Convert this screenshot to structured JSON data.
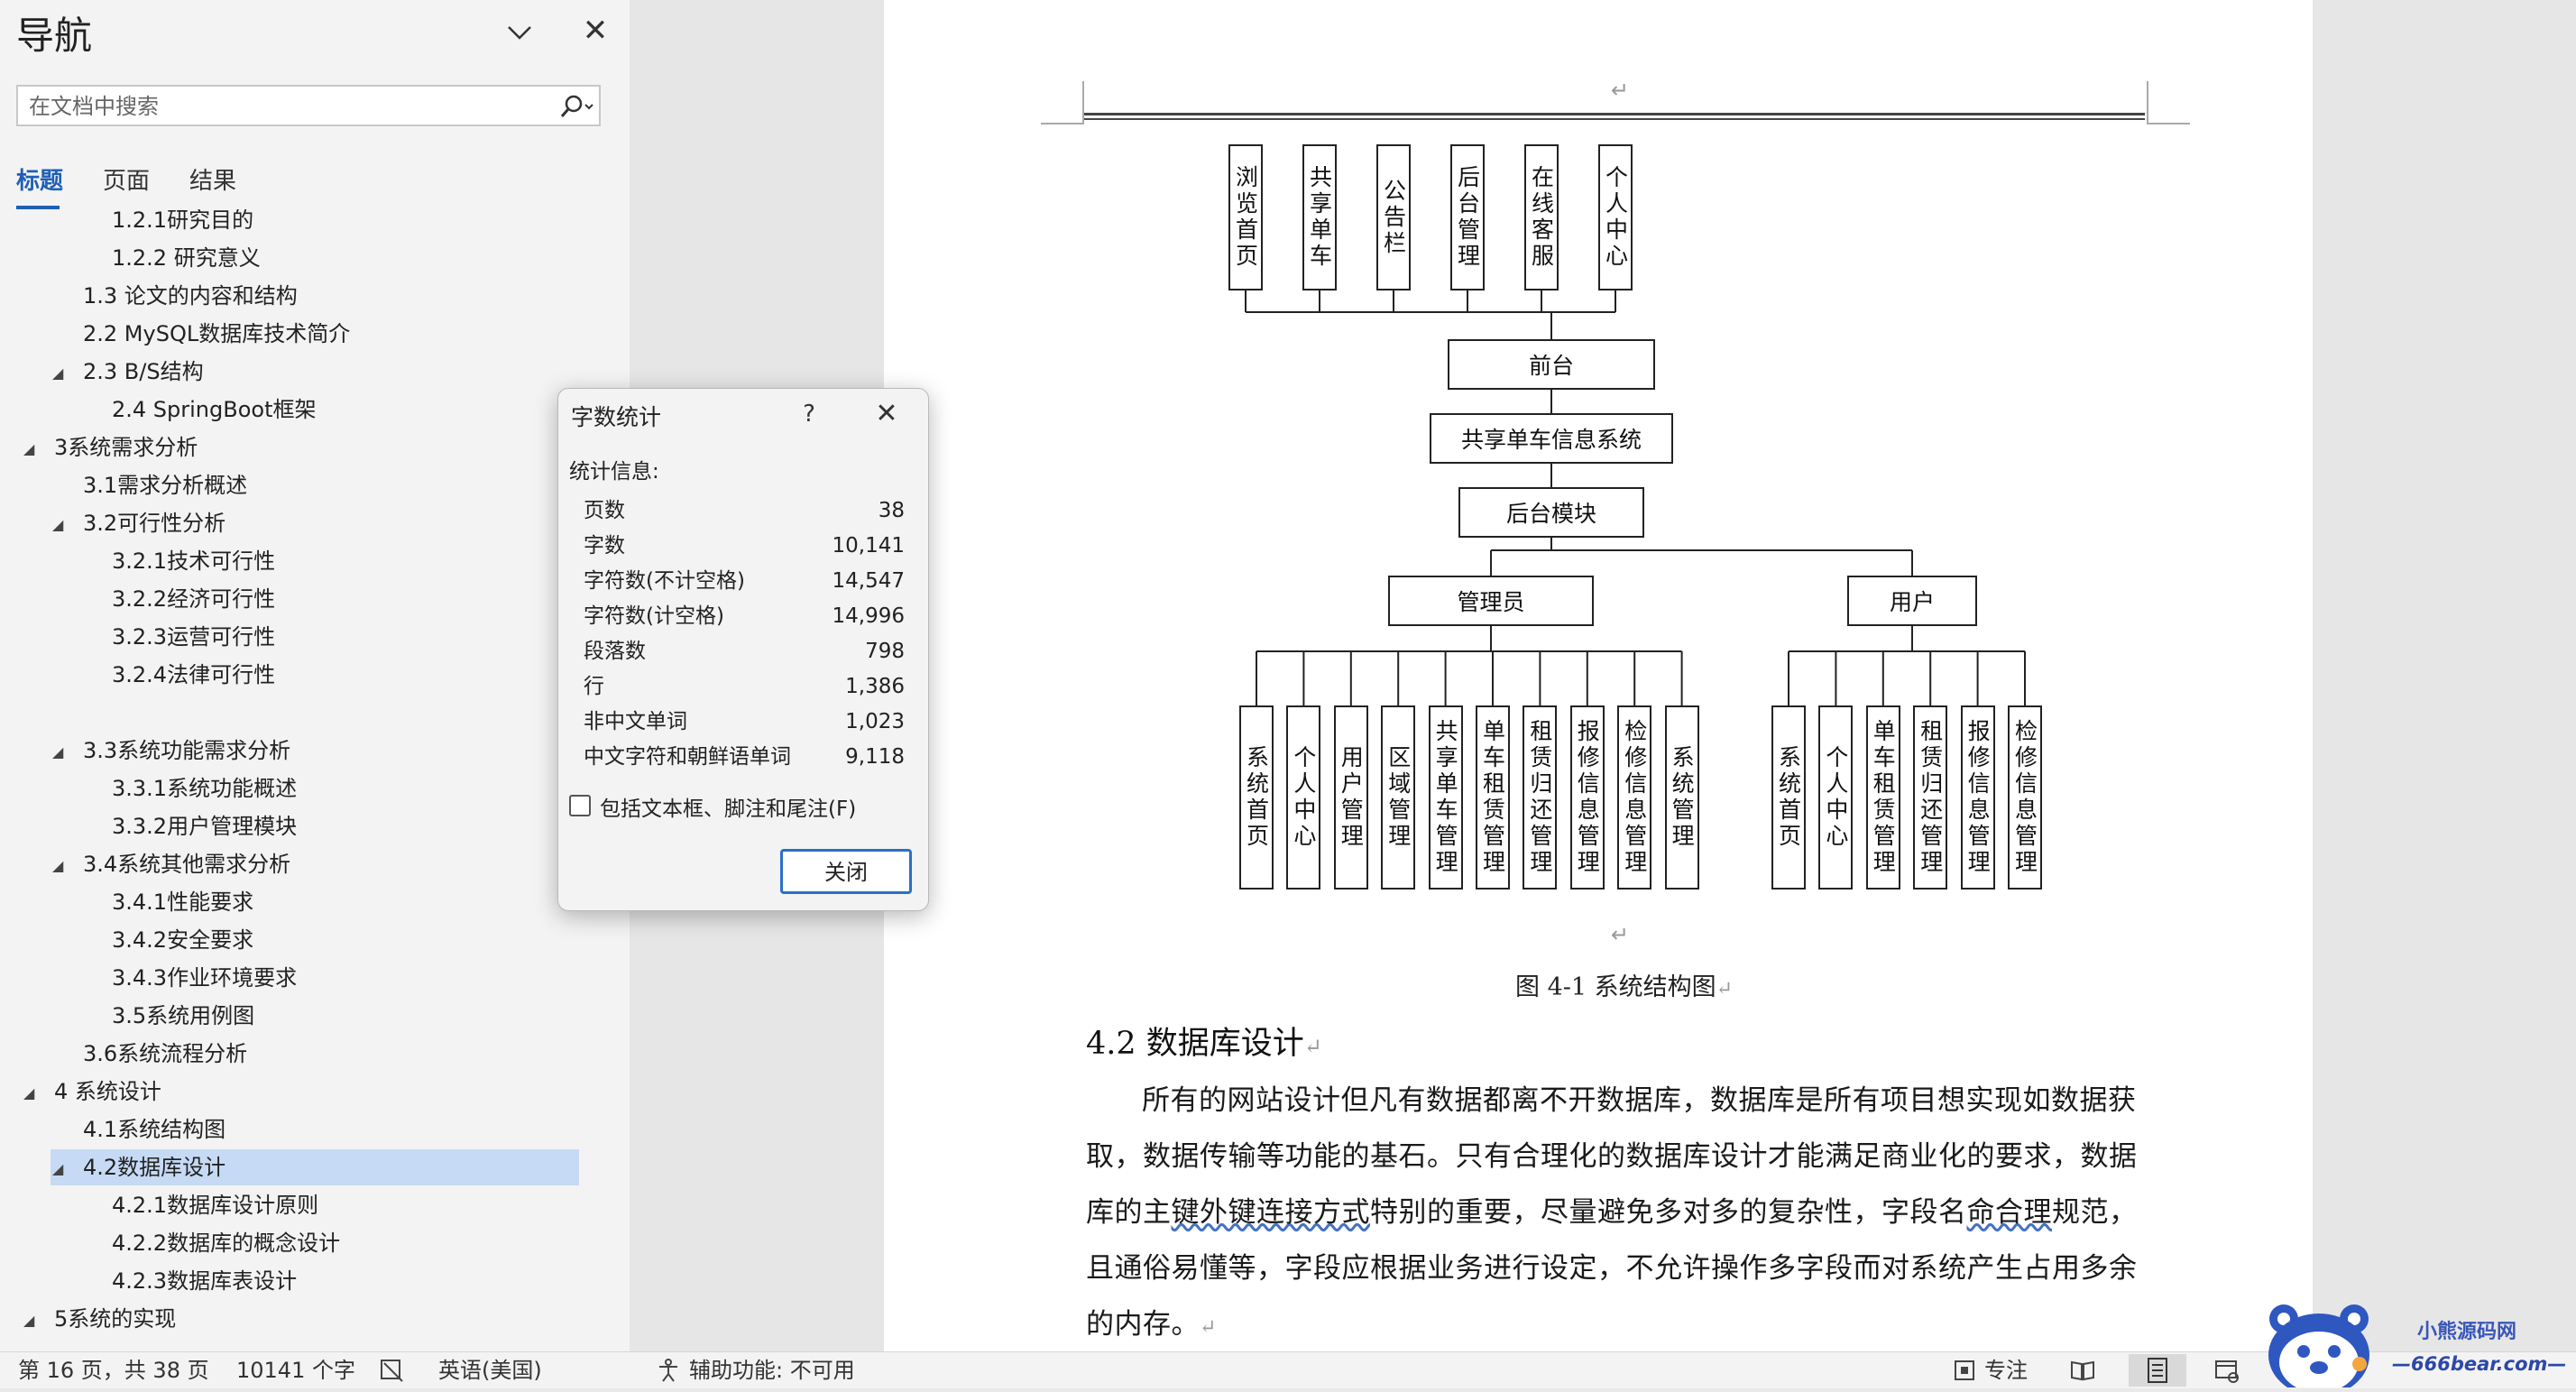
{
  "nav": {
    "title": "导航",
    "search_placeholder": "在文档中搜索",
    "tabs": [
      "标题",
      "页面",
      "结果"
    ],
    "tree": [
      {
        "label": "1.2.1研究目的",
        "level": 3
      },
      {
        "label": "1.2.2 研究意义",
        "level": 3
      },
      {
        "label": "1.3 论文的内容和结构",
        "level": 2
      },
      {
        "label": "2.2 MySQL数据库技术简介",
        "level": 2
      },
      {
        "label": "2.3 B/S结构",
        "level": 2,
        "expanded": true
      },
      {
        "label": "2.4 SpringBoot框架",
        "level": 3
      },
      {
        "label": "3系统需求分析",
        "level": 1,
        "expanded": true
      },
      {
        "label": "3.1需求分析概述",
        "level": 2
      },
      {
        "label": "3.2可行性分析",
        "level": 2,
        "expanded": true
      },
      {
        "label": "3.2.1技术可行性",
        "level": 3
      },
      {
        "label": "3.2.2经济可行性",
        "level": 3
      },
      {
        "label": "3.2.3运营可行性",
        "level": 3
      },
      {
        "label": "3.2.4法律可行性",
        "level": 3
      },
      {
        "label": "",
        "level": 3
      },
      {
        "label": "3.3系统功能需求分析",
        "level": 2,
        "expanded": true
      },
      {
        "label": "3.3.1系统功能概述",
        "level": 3
      },
      {
        "label": "3.3.2用户管理模块",
        "level": 3
      },
      {
        "label": "3.4系统其他需求分析",
        "level": 2,
        "expanded": true
      },
      {
        "label": "3.4.1性能要求",
        "level": 3
      },
      {
        "label": "3.4.2安全要求",
        "level": 3
      },
      {
        "label": "3.4.3作业环境要求",
        "level": 3
      },
      {
        "label": "3.5系统用例图",
        "level": 3
      },
      {
        "label": "3.6系统流程分析",
        "level": 2
      },
      {
        "label": "4 系统设计",
        "level": 1,
        "expanded": true
      },
      {
        "label": "4.1系统结构图",
        "level": 2
      },
      {
        "label": "4.2数据库设计",
        "level": 2,
        "expanded": true,
        "selected": true
      },
      {
        "label": "4.2.1数据库设计原则",
        "level": 3
      },
      {
        "label": "4.2.2数据库的概念设计",
        "level": 3
      },
      {
        "label": "4.2.3数据库表设计",
        "level": 3
      },
      {
        "label": "5系统的实现",
        "level": 1,
        "expanded": true
      }
    ]
  },
  "word_count": {
    "title": "字数统计",
    "help": "?",
    "section": "统计信息:",
    "rows": [
      {
        "label": "页数",
        "value": "38"
      },
      {
        "label": "字数",
        "value": "10,141"
      },
      {
        "label": "字符数(不计空格)",
        "value": "14,547"
      },
      {
        "label": "字符数(计空格)",
        "value": "14,996"
      },
      {
        "label": "段落数",
        "value": "798"
      },
      {
        "label": "行",
        "value": "1,386"
      },
      {
        "label": "非中文单词",
        "value": "1,023"
      },
      {
        "label": "中文字符和朝鲜语单词",
        "value": "9,118"
      }
    ],
    "checkbox_label": "包括文本框、脚注和尾注(F)",
    "checkbox_checked": false,
    "close_button": "关闭"
  },
  "document": {
    "diagram": {
      "top_modules": [
        "浏览首页",
        "共享单车",
        "公告栏",
        "后台管理",
        "在线客服",
        "个人中心"
      ],
      "front": "前台",
      "system": "共享单车信息系统",
      "backend": "后台模块",
      "admin": "管理员",
      "user": "用户",
      "admin_modules": [
        "系统首页",
        "个人中心",
        "用户管理",
        "区域管理",
        "共享单车管理",
        "单车租赁管理",
        "租赁归还管理",
        "报修信息管理",
        "检修信息管理",
        "系统管理"
      ],
      "user_modules": [
        "系统首页",
        "个人中心",
        "单车租赁管理",
        "租赁归还管理",
        "报修信息管理",
        "检修信息管理"
      ]
    },
    "caption": "图 4-1 系统结构图",
    "heading": "4.2 数据库设计",
    "para_mark": "↵",
    "lines": [
      {
        "pre": "所有的网站设计但凡有数据都离不开数据库，数据库是所有项目想实现如数据获",
        "u": "",
        "post": ""
      },
      {
        "pre": "取，数据传输等功能的基石。只有合理化的数据库设计才能满足商业化的要求，数据",
        "u": "",
        "post": ""
      },
      {
        "pre": "库的主",
        "u": "键外键连接方式",
        "post": "特别的重要，尽量避免多对多的复杂性，字段名",
        "u2": "命合理",
        "post2": "规范，"
      },
      {
        "pre": "且通俗易懂等，字段应根据业务进行设定，不允许操作多字段而对系统产生占用多余",
        "u": "",
        "post": ""
      },
      {
        "pre": "的内存。",
        "u": "",
        "post": ""
      }
    ]
  },
  "status": {
    "page": "第 16 页，共 38 页",
    "words": "10141 个字",
    "language": "英语(美国)",
    "accessibility": "辅助功能: 不可用",
    "focus": "专注"
  },
  "watermark": {
    "line1": "小熊源码网",
    "line2": "—666bear.com—"
  }
}
